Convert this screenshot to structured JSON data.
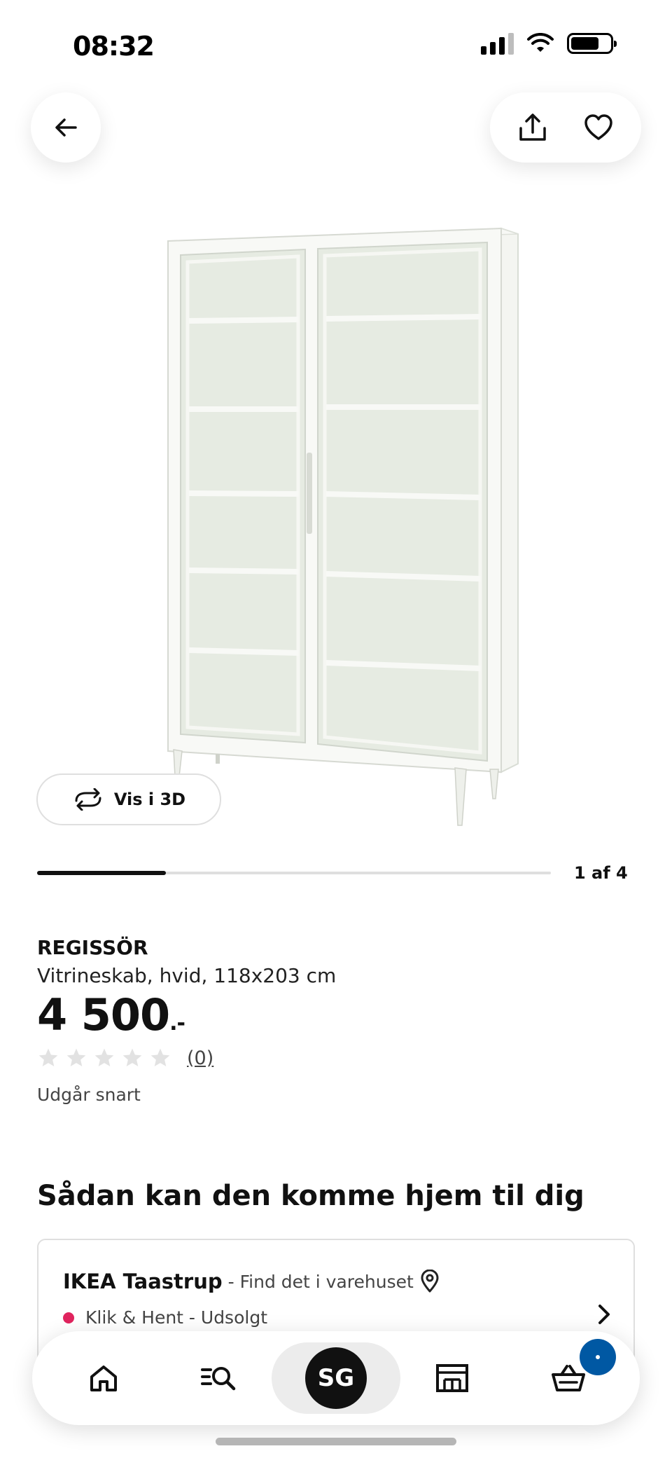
{
  "status_bar": {
    "time": "08:32"
  },
  "carousel": {
    "counter": "1 af 4",
    "progress": 0.25
  },
  "view_3d": {
    "label": "Vis i 3D"
  },
  "product": {
    "name": "REGISSÖR",
    "description": "Vitrineskab, hvid, 118x203 cm",
    "price": "4 500",
    "price_suffix": ".-",
    "rating_stars": 0,
    "review_count": "(0)",
    "availability": "Udgår snart"
  },
  "delivery": {
    "heading": "Sådan kan den komme hjem til dig",
    "store_name": "IKEA Taastrup",
    "store_find": " - Find det i varehuset",
    "pickup_status": "Klik & Hent - Udsolgt"
  },
  "nav": {
    "avatar_initials": "SG"
  },
  "icons": {
    "back": "arrow-left-icon",
    "share": "share-icon",
    "favorite": "heart-icon",
    "rotate": "rotate-3d-icon",
    "location": "location-pin-icon",
    "home": "home-icon",
    "search": "search-icon",
    "stores": "store-icon",
    "cart": "cart-icon"
  },
  "colors": {
    "pickup_status_dot": "#e0245e",
    "cart_badge": "#0058a3",
    "cabinet_glass": "#e6ebe2"
  }
}
